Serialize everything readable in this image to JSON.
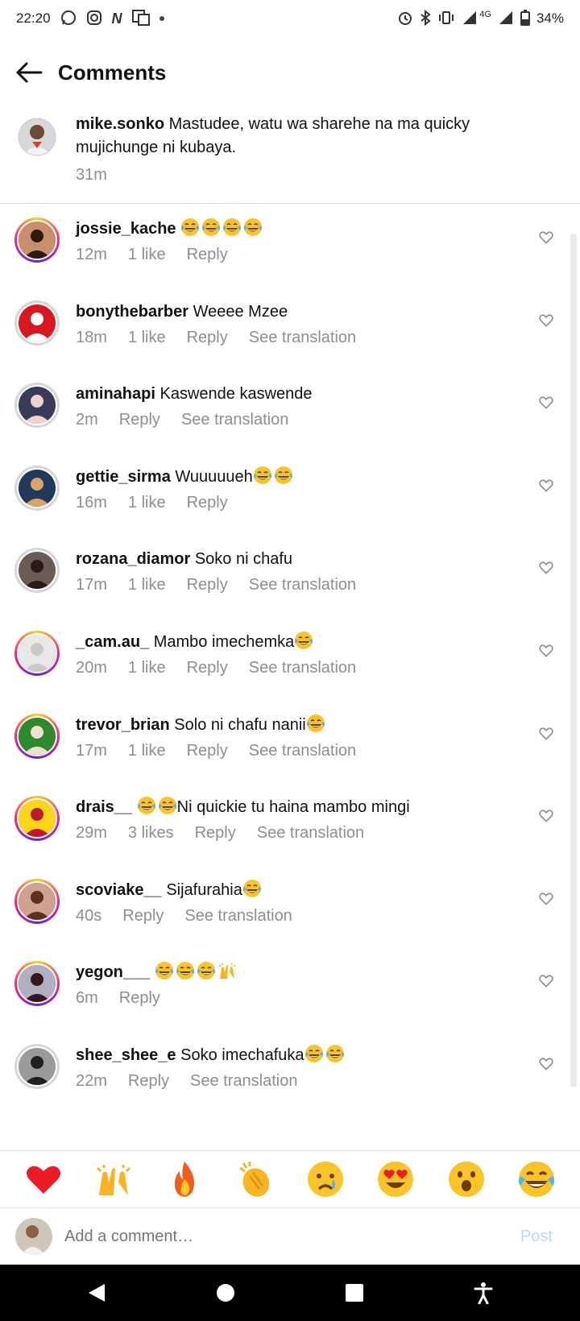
{
  "status_bar": {
    "time": "22:20",
    "network": "4G",
    "battery": "34%"
  },
  "header": {
    "title": "Comments"
  },
  "caption": {
    "username": "mike.sonko",
    "text": "Mastudee,  watu wa sharehe na ma quicky mujichunge ni kubaya.",
    "time": "31m"
  },
  "comments": [
    {
      "username": "jossie_kache",
      "text": "",
      "emojis": [
        "joy",
        "joy",
        "joy",
        "joy"
      ],
      "time": "12m",
      "likes": "1 like",
      "reply": "Reply",
      "translate": ""
    },
    {
      "username": "bonythebarber",
      "text": "Weeee Mzee",
      "emojis": [],
      "time": "18m",
      "likes": "1 like",
      "reply": "Reply",
      "translate": "See translation"
    },
    {
      "username": "aminahapi",
      "text": "Kaswende kaswende",
      "emojis": [],
      "time": "2m",
      "likes": "",
      "reply": "Reply",
      "translate": "See translation"
    },
    {
      "username": "gettie_sirma",
      "text": "Wuuuuueh",
      "emojis": [
        "joy",
        "joy"
      ],
      "time": "16m",
      "likes": "1 like",
      "reply": "Reply",
      "translate": ""
    },
    {
      "username": "rozana_diamor",
      "text": "Soko ni chafu",
      "emojis": [],
      "time": "17m",
      "likes": "1 like",
      "reply": "Reply",
      "translate": "See translation"
    },
    {
      "username": "_cam.au_",
      "text": "Mambo imechemka",
      "emojis": [
        "joy"
      ],
      "time": "20m",
      "likes": "1 like",
      "reply": "Reply",
      "translate": "See translation"
    },
    {
      "username": "trevor_brian",
      "text": "Solo ni chafu nanii",
      "emojis": [
        "joy"
      ],
      "time": "17m",
      "likes": "1 like",
      "reply": "Reply",
      "translate": "See translation"
    },
    {
      "username": "drais__",
      "text": "Ni quickie tu haina mambo mingi",
      "emojis_before": [
        "joy",
        "joy"
      ],
      "emojis": [],
      "time": "29m",
      "likes": "3 likes",
      "reply": "Reply",
      "translate": "See translation"
    },
    {
      "username": "scoviake__",
      "text": "Sijafurahia",
      "emojis": [
        "joy"
      ],
      "time": "40s",
      "likes": "",
      "reply": "Reply",
      "translate": "See translation"
    },
    {
      "username": "yegon___",
      "text": "",
      "emojis": [
        "joy",
        "joy",
        "joy",
        "raised-hands"
      ],
      "time": "6m",
      "likes": "",
      "reply": "Reply",
      "translate": ""
    },
    {
      "username": "shee_shee_e",
      "text": "Soko imechafuka",
      "emojis": [
        "joy",
        "joy"
      ],
      "time": "22m",
      "likes": "",
      "reply": "Reply",
      "translate": "See translation"
    }
  ],
  "reactions": [
    "red-heart",
    "raised-hands",
    "fire",
    "clapping-hands",
    "crying-face",
    "heart-eyes",
    "surprised-face",
    "tears-of-joy"
  ],
  "add_comment": {
    "placeholder": "Add a comment…",
    "post_label": "Post"
  },
  "colors": {
    "link_gray": "#8e8e8e",
    "post_blue": "#b3dbff",
    "heart_red": "#ed1c24"
  }
}
